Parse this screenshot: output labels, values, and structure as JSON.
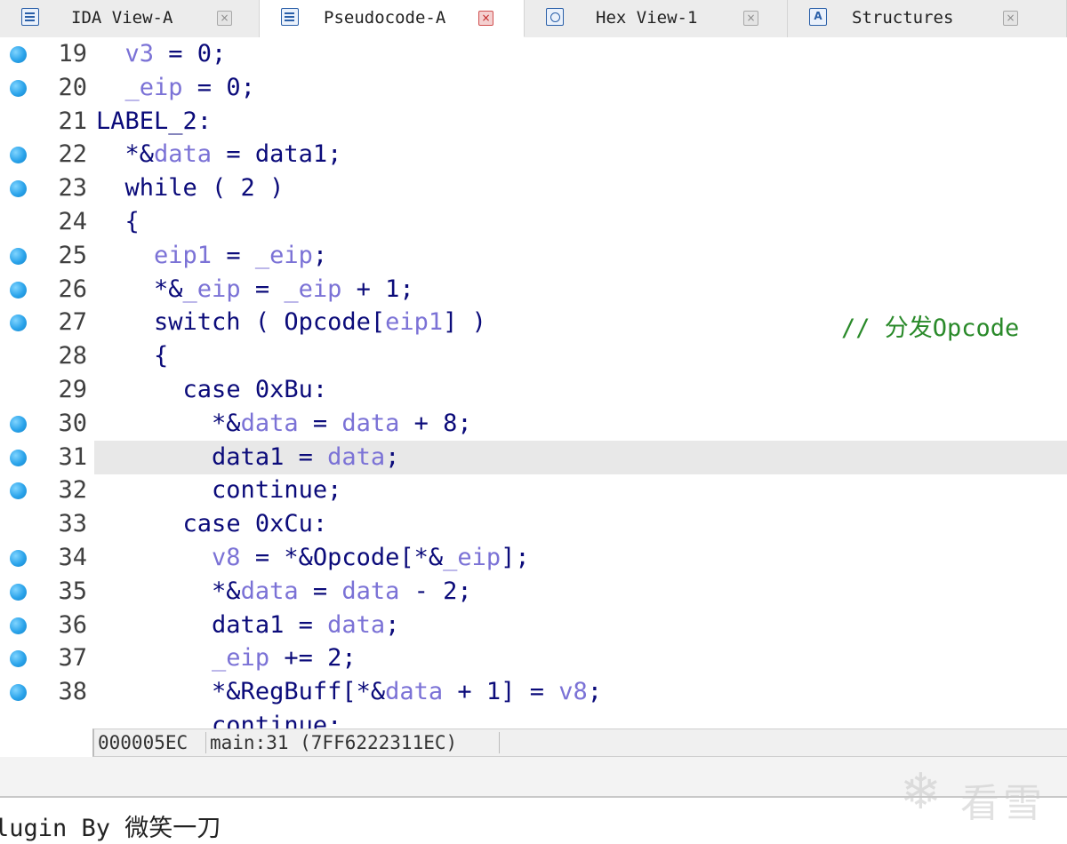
{
  "tabs": [
    {
      "label": "IDA View-A",
      "icon": "document-icon",
      "active": false
    },
    {
      "label": "Pseudocode-A",
      "icon": "document-icon",
      "active": true
    },
    {
      "label": "Hex View-1",
      "icon": "hex-icon",
      "active": false
    },
    {
      "label": "Structures",
      "icon": "structures-icon",
      "active": false
    }
  ],
  "tab_close_glyph": "×",
  "structures_icon_glyph": "A",
  "code": {
    "highlighted_line": 31,
    "lines": [
      {
        "n": "19",
        "bp": true,
        "indent": "  ",
        "parts": [
          [
            "v",
            "v3"
          ],
          [
            "k",
            " = 0;"
          ]
        ]
      },
      {
        "n": "20",
        "bp": true,
        "indent": "  ",
        "parts": [
          [
            "v",
            "_eip"
          ],
          [
            "k",
            " = 0;"
          ]
        ]
      },
      {
        "n": "21",
        "bp": false,
        "indent": "",
        "parts": [
          [
            "k",
            "LABEL_2:"
          ]
        ]
      },
      {
        "n": "22",
        "bp": true,
        "indent": "  ",
        "parts": [
          [
            "k",
            "*&"
          ],
          [
            "v",
            "data"
          ],
          [
            "k",
            " = data1;"
          ]
        ]
      },
      {
        "n": "23",
        "bp": true,
        "indent": "  ",
        "parts": [
          [
            "k",
            "while ( 2 )"
          ]
        ]
      },
      {
        "n": "24",
        "bp": false,
        "indent": "  ",
        "parts": [
          [
            "k",
            "{"
          ]
        ]
      },
      {
        "n": "25",
        "bp": true,
        "indent": "    ",
        "parts": [
          [
            "v",
            "eip1"
          ],
          [
            "k",
            " = "
          ],
          [
            "v",
            "_eip"
          ],
          [
            "k",
            ";"
          ]
        ]
      },
      {
        "n": "26",
        "bp": true,
        "indent": "    ",
        "parts": [
          [
            "k",
            "*&"
          ],
          [
            "v",
            "_eip"
          ],
          [
            "k",
            " = "
          ],
          [
            "v",
            "_eip"
          ],
          [
            "k",
            " + 1;"
          ]
        ]
      },
      {
        "n": "27",
        "bp": true,
        "indent": "    ",
        "parts": [
          [
            "k",
            "switch ( Opcode["
          ],
          [
            "v",
            "eip1"
          ],
          [
            "k",
            "] )"
          ]
        ],
        "comment": "// 分发Opcode"
      },
      {
        "n": "28",
        "bp": false,
        "indent": "    ",
        "parts": [
          [
            "k",
            "{"
          ]
        ]
      },
      {
        "n": "29",
        "bp": false,
        "indent": "      ",
        "parts": [
          [
            "k",
            "case 0xBu:"
          ]
        ]
      },
      {
        "n": "30",
        "bp": true,
        "indent": "        ",
        "parts": [
          [
            "k",
            "*&"
          ],
          [
            "v",
            "data"
          ],
          [
            "k",
            " = "
          ],
          [
            "v",
            "data"
          ],
          [
            "k",
            " + 8;"
          ]
        ]
      },
      {
        "n": "31",
        "bp": true,
        "indent": "        ",
        "parts": [
          [
            "k",
            "data1 = "
          ],
          [
            "v",
            "data"
          ],
          [
            "k",
            ";"
          ]
        ]
      },
      {
        "n": "32",
        "bp": true,
        "indent": "        ",
        "parts": [
          [
            "k",
            "continue;"
          ]
        ]
      },
      {
        "n": "33",
        "bp": false,
        "indent": "      ",
        "parts": [
          [
            "k",
            "case 0xCu:"
          ]
        ]
      },
      {
        "n": "34",
        "bp": true,
        "indent": "        ",
        "parts": [
          [
            "v",
            "v8"
          ],
          [
            "k",
            " = *&Opcode[*&"
          ],
          [
            "v",
            "_eip"
          ],
          [
            "k",
            "];"
          ]
        ]
      },
      {
        "n": "35",
        "bp": true,
        "indent": "        ",
        "parts": [
          [
            "k",
            "*&"
          ],
          [
            "v",
            "data"
          ],
          [
            "k",
            " = "
          ],
          [
            "v",
            "data"
          ],
          [
            "k",
            " - 2;"
          ]
        ]
      },
      {
        "n": "36",
        "bp": true,
        "indent": "        ",
        "parts": [
          [
            "k",
            "data1 = "
          ],
          [
            "v",
            "data"
          ],
          [
            "k",
            ";"
          ]
        ]
      },
      {
        "n": "37",
        "bp": true,
        "indent": "        ",
        "parts": [
          [
            "v",
            "_eip"
          ],
          [
            "k",
            " += 2;"
          ]
        ]
      },
      {
        "n": "38",
        "bp": true,
        "indent": "        ",
        "parts": [
          [
            "k",
            "*&RegBuff[*&"
          ],
          [
            "v",
            "data"
          ],
          [
            "k",
            " + 1] = "
          ],
          [
            "v",
            "v8"
          ],
          [
            "k",
            ";"
          ]
        ]
      },
      {
        "n": "",
        "bp": false,
        "indent": "        ",
        "parts": [
          [
            "k",
            "continue;"
          ]
        ]
      }
    ]
  },
  "status": {
    "address": "000005EC",
    "location": "main:31 (7FF6222311EC)"
  },
  "output": {
    "line": "lugin By 微笑一刀"
  },
  "watermark": {
    "glyph": "❄",
    "text": "看雪"
  },
  "colors": {
    "keyword": "#0b0b7a",
    "variable": "#7b72d6",
    "comment": "#2a8a2a",
    "breakpoint": "#2aa3ea",
    "highlight_row": "#e8e8e8"
  }
}
